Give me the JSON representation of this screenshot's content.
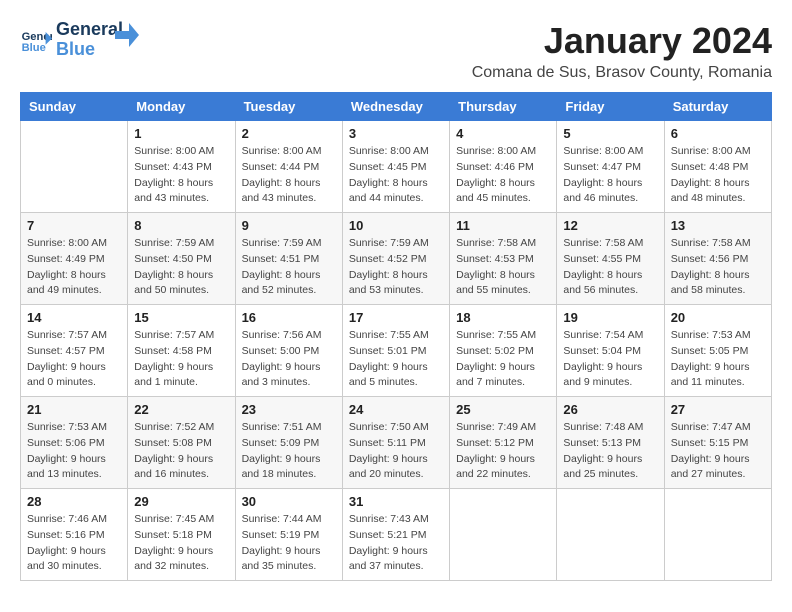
{
  "header": {
    "logo_line1": "General",
    "logo_line2": "Blue",
    "month": "January 2024",
    "location": "Comana de Sus, Brasov County, Romania"
  },
  "weekdays": [
    "Sunday",
    "Monday",
    "Tuesday",
    "Wednesday",
    "Thursday",
    "Friday",
    "Saturday"
  ],
  "weeks": [
    [
      {
        "day": "",
        "sunrise": "",
        "sunset": "",
        "daylight": ""
      },
      {
        "day": "1",
        "sunrise": "Sunrise: 8:00 AM",
        "sunset": "Sunset: 4:43 PM",
        "daylight": "Daylight: 8 hours and 43 minutes."
      },
      {
        "day": "2",
        "sunrise": "Sunrise: 8:00 AM",
        "sunset": "Sunset: 4:44 PM",
        "daylight": "Daylight: 8 hours and 43 minutes."
      },
      {
        "day": "3",
        "sunrise": "Sunrise: 8:00 AM",
        "sunset": "Sunset: 4:45 PM",
        "daylight": "Daylight: 8 hours and 44 minutes."
      },
      {
        "day": "4",
        "sunrise": "Sunrise: 8:00 AM",
        "sunset": "Sunset: 4:46 PM",
        "daylight": "Daylight: 8 hours and 45 minutes."
      },
      {
        "day": "5",
        "sunrise": "Sunrise: 8:00 AM",
        "sunset": "Sunset: 4:47 PM",
        "daylight": "Daylight: 8 hours and 46 minutes."
      },
      {
        "day": "6",
        "sunrise": "Sunrise: 8:00 AM",
        "sunset": "Sunset: 4:48 PM",
        "daylight": "Daylight: 8 hours and 48 minutes."
      }
    ],
    [
      {
        "day": "7",
        "sunrise": "Sunrise: 8:00 AM",
        "sunset": "Sunset: 4:49 PM",
        "daylight": "Daylight: 8 hours and 49 minutes."
      },
      {
        "day": "8",
        "sunrise": "Sunrise: 7:59 AM",
        "sunset": "Sunset: 4:50 PM",
        "daylight": "Daylight: 8 hours and 50 minutes."
      },
      {
        "day": "9",
        "sunrise": "Sunrise: 7:59 AM",
        "sunset": "Sunset: 4:51 PM",
        "daylight": "Daylight: 8 hours and 52 minutes."
      },
      {
        "day": "10",
        "sunrise": "Sunrise: 7:59 AM",
        "sunset": "Sunset: 4:52 PM",
        "daylight": "Daylight: 8 hours and 53 minutes."
      },
      {
        "day": "11",
        "sunrise": "Sunrise: 7:58 AM",
        "sunset": "Sunset: 4:53 PM",
        "daylight": "Daylight: 8 hours and 55 minutes."
      },
      {
        "day": "12",
        "sunrise": "Sunrise: 7:58 AM",
        "sunset": "Sunset: 4:55 PM",
        "daylight": "Daylight: 8 hours and 56 minutes."
      },
      {
        "day": "13",
        "sunrise": "Sunrise: 7:58 AM",
        "sunset": "Sunset: 4:56 PM",
        "daylight": "Daylight: 8 hours and 58 minutes."
      }
    ],
    [
      {
        "day": "14",
        "sunrise": "Sunrise: 7:57 AM",
        "sunset": "Sunset: 4:57 PM",
        "daylight": "Daylight: 9 hours and 0 minutes."
      },
      {
        "day": "15",
        "sunrise": "Sunrise: 7:57 AM",
        "sunset": "Sunset: 4:58 PM",
        "daylight": "Daylight: 9 hours and 1 minute."
      },
      {
        "day": "16",
        "sunrise": "Sunrise: 7:56 AM",
        "sunset": "Sunset: 5:00 PM",
        "daylight": "Daylight: 9 hours and 3 minutes."
      },
      {
        "day": "17",
        "sunrise": "Sunrise: 7:55 AM",
        "sunset": "Sunset: 5:01 PM",
        "daylight": "Daylight: 9 hours and 5 minutes."
      },
      {
        "day": "18",
        "sunrise": "Sunrise: 7:55 AM",
        "sunset": "Sunset: 5:02 PM",
        "daylight": "Daylight: 9 hours and 7 minutes."
      },
      {
        "day": "19",
        "sunrise": "Sunrise: 7:54 AM",
        "sunset": "Sunset: 5:04 PM",
        "daylight": "Daylight: 9 hours and 9 minutes."
      },
      {
        "day": "20",
        "sunrise": "Sunrise: 7:53 AM",
        "sunset": "Sunset: 5:05 PM",
        "daylight": "Daylight: 9 hours and 11 minutes."
      }
    ],
    [
      {
        "day": "21",
        "sunrise": "Sunrise: 7:53 AM",
        "sunset": "Sunset: 5:06 PM",
        "daylight": "Daylight: 9 hours and 13 minutes."
      },
      {
        "day": "22",
        "sunrise": "Sunrise: 7:52 AM",
        "sunset": "Sunset: 5:08 PM",
        "daylight": "Daylight: 9 hours and 16 minutes."
      },
      {
        "day": "23",
        "sunrise": "Sunrise: 7:51 AM",
        "sunset": "Sunset: 5:09 PM",
        "daylight": "Daylight: 9 hours and 18 minutes."
      },
      {
        "day": "24",
        "sunrise": "Sunrise: 7:50 AM",
        "sunset": "Sunset: 5:11 PM",
        "daylight": "Daylight: 9 hours and 20 minutes."
      },
      {
        "day": "25",
        "sunrise": "Sunrise: 7:49 AM",
        "sunset": "Sunset: 5:12 PM",
        "daylight": "Daylight: 9 hours and 22 minutes."
      },
      {
        "day": "26",
        "sunrise": "Sunrise: 7:48 AM",
        "sunset": "Sunset: 5:13 PM",
        "daylight": "Daylight: 9 hours and 25 minutes."
      },
      {
        "day": "27",
        "sunrise": "Sunrise: 7:47 AM",
        "sunset": "Sunset: 5:15 PM",
        "daylight": "Daylight: 9 hours and 27 minutes."
      }
    ],
    [
      {
        "day": "28",
        "sunrise": "Sunrise: 7:46 AM",
        "sunset": "Sunset: 5:16 PM",
        "daylight": "Daylight: 9 hours and 30 minutes."
      },
      {
        "day": "29",
        "sunrise": "Sunrise: 7:45 AM",
        "sunset": "Sunset: 5:18 PM",
        "daylight": "Daylight: 9 hours and 32 minutes."
      },
      {
        "day": "30",
        "sunrise": "Sunrise: 7:44 AM",
        "sunset": "Sunset: 5:19 PM",
        "daylight": "Daylight: 9 hours and 35 minutes."
      },
      {
        "day": "31",
        "sunrise": "Sunrise: 7:43 AM",
        "sunset": "Sunset: 5:21 PM",
        "daylight": "Daylight: 9 hours and 37 minutes."
      },
      {
        "day": "",
        "sunrise": "",
        "sunset": "",
        "daylight": ""
      },
      {
        "day": "",
        "sunrise": "",
        "sunset": "",
        "daylight": ""
      },
      {
        "day": "",
        "sunrise": "",
        "sunset": "",
        "daylight": ""
      }
    ]
  ]
}
